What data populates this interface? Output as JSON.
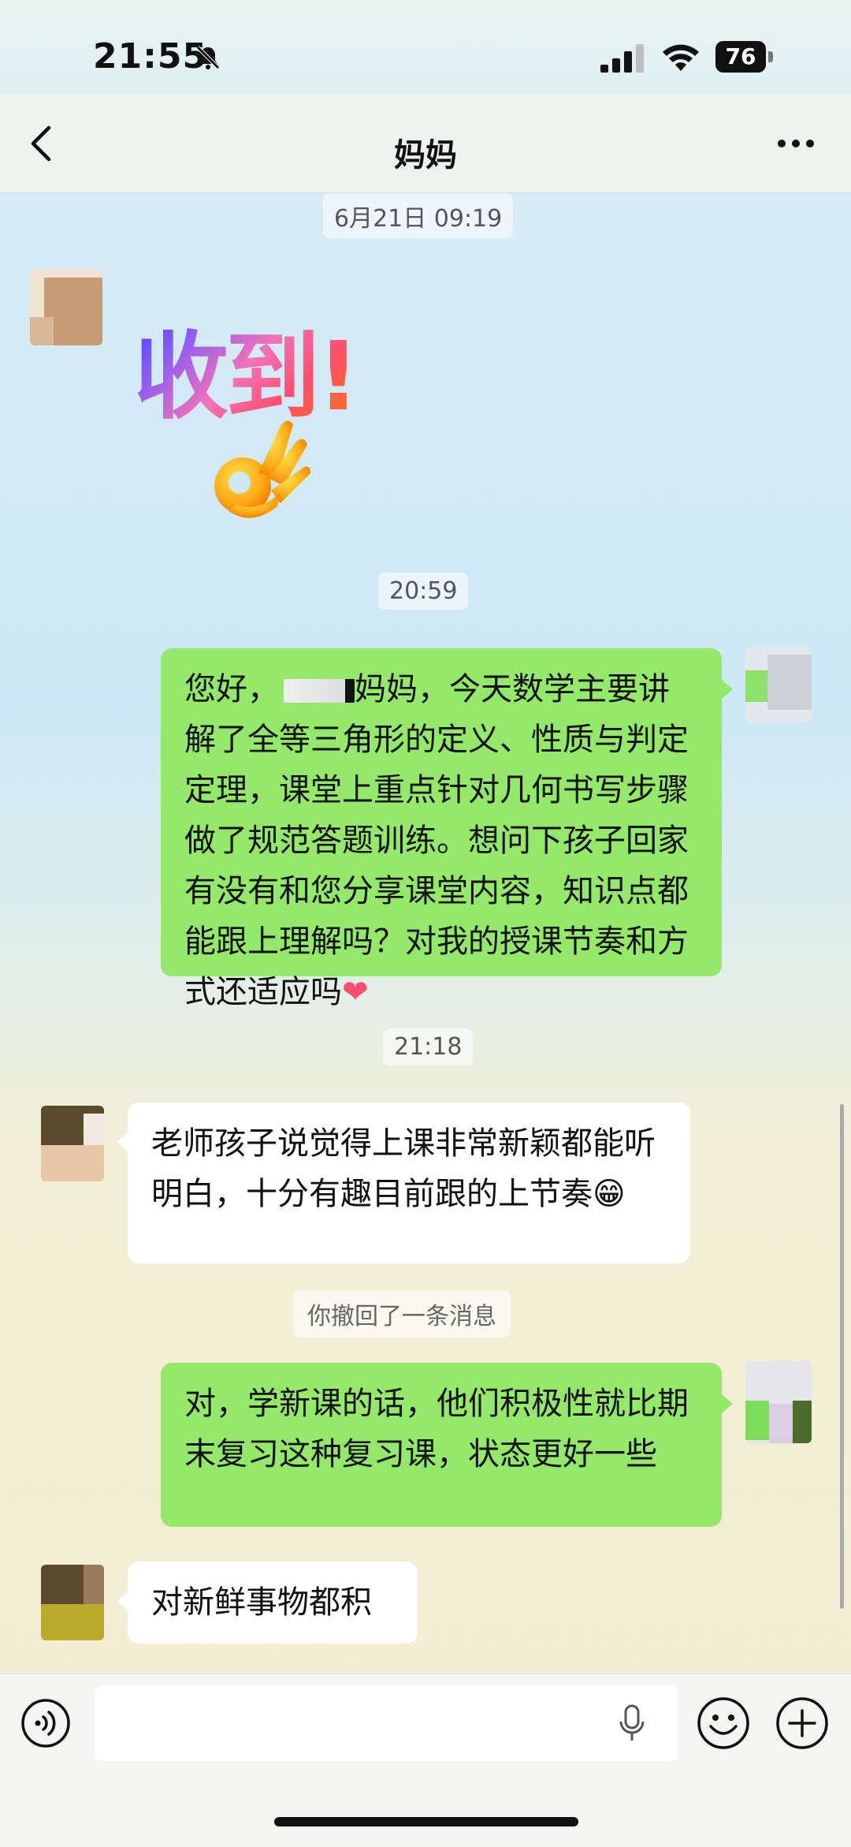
{
  "status_bar": {
    "time": "21:55",
    "battery": "76"
  },
  "header": {
    "title": "妈妈"
  },
  "timestamps": [
    "6月21日 09:19",
    "20:59",
    "21:18"
  ],
  "sticker": {
    "text": "收到!"
  },
  "messages": [
    {
      "side": "out",
      "pre": "您好，",
      "post": "妈妈，今天数学主要讲解了全等三角形的定义、性质与判定定理，课堂上重点针对几何书写步骤做了规范答题训练。想问下孩子回家有没有和您分享课堂内容，知识点都能跟上理解吗？对我的授课节奏和方式还适应吗",
      "emoji": "❤"
    },
    {
      "side": "in",
      "text": "老师孩子说觉得上课非常新颖都能听明白，十分有趣目前跟的上节奏",
      "emoji": "😁"
    },
    {
      "side": "out",
      "text": "对，学新课的话，他们积极性就比期末复习这种复习课，状态更好一些"
    },
    {
      "side": "in",
      "text": "对新鲜事物都积"
    }
  ],
  "system_note": "你撤回了一条消息",
  "colors": {
    "outgoing_bubble": "#94e96a",
    "incoming_bubble": "#ffffff"
  },
  "icons": [
    "bell-slash-icon",
    "signal-icon",
    "wifi-icon",
    "back-icon",
    "more-icon",
    "ok-hand-icon",
    "voice-icon",
    "mic-icon",
    "emoji-icon",
    "plus-icon"
  ]
}
